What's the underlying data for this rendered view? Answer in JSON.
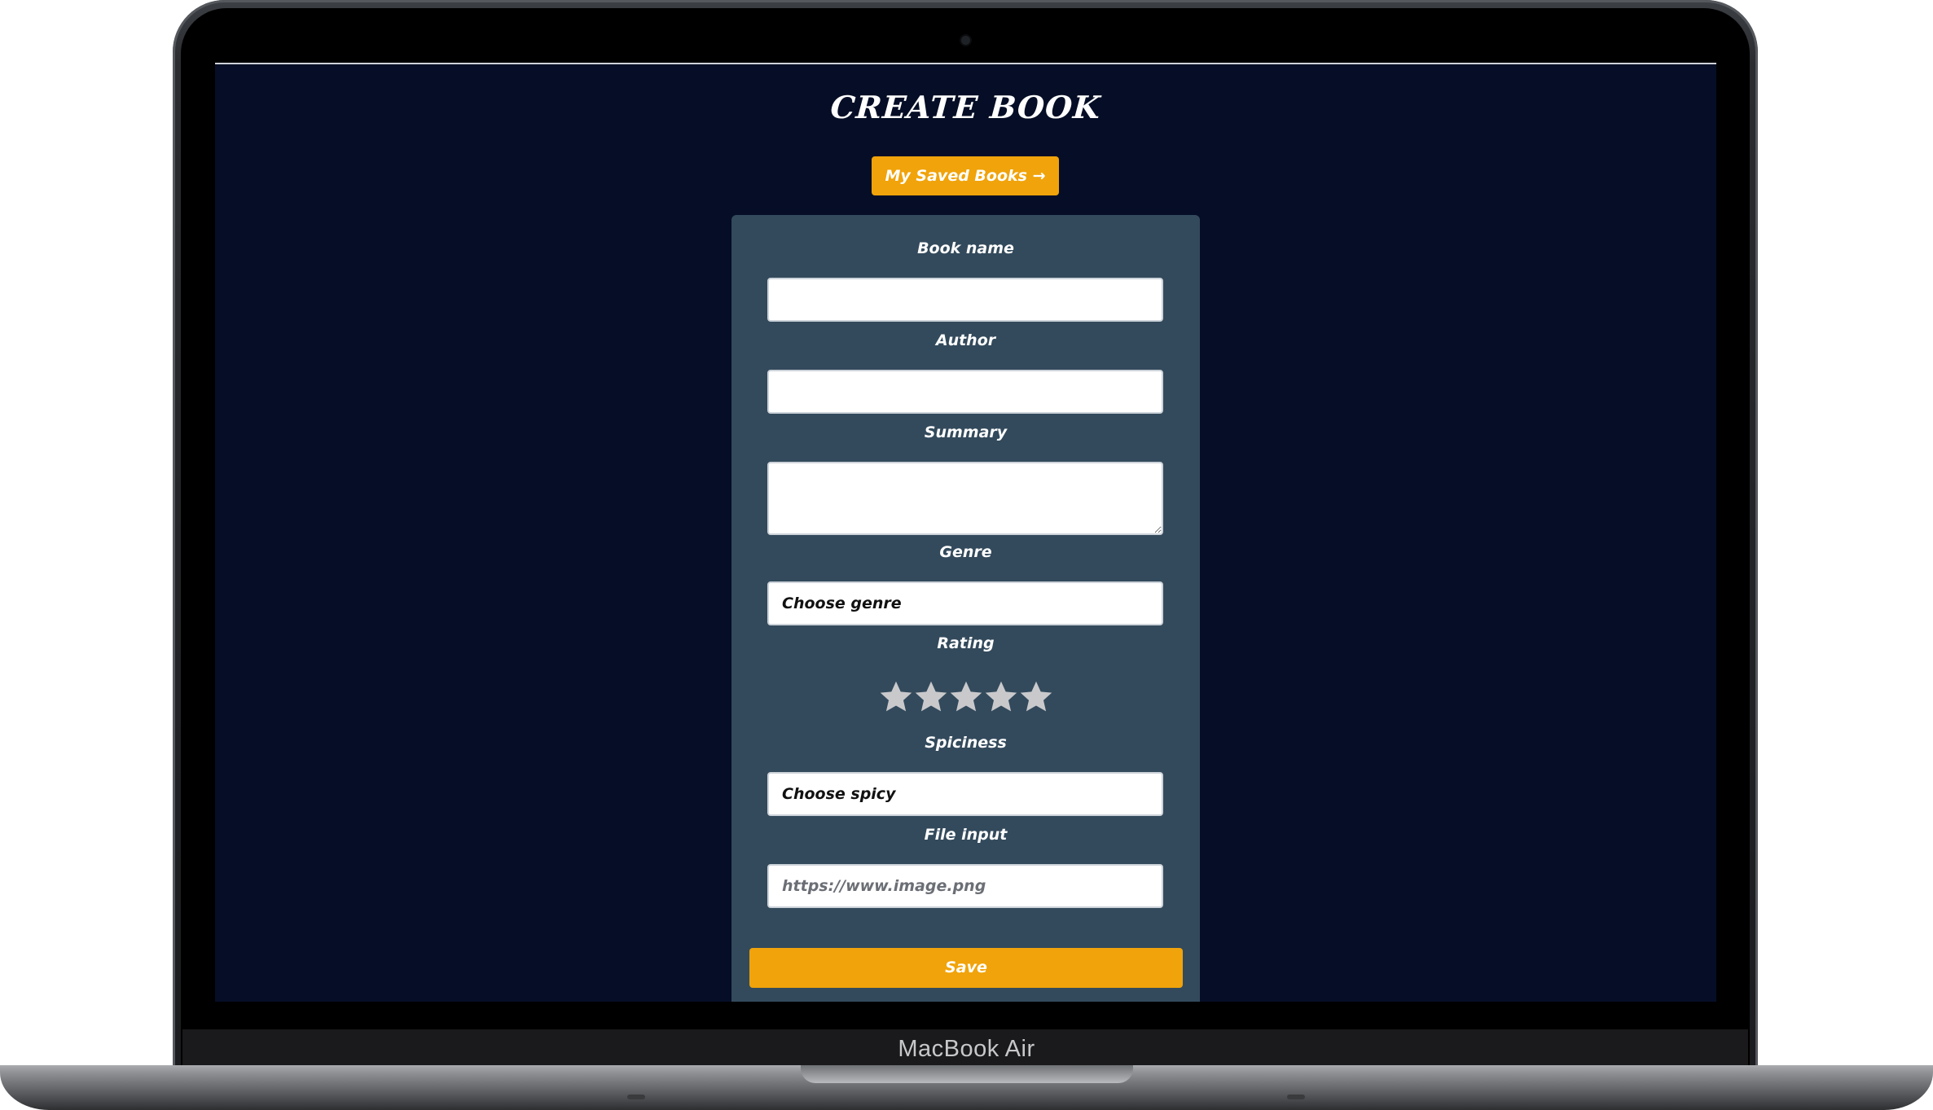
{
  "device": {
    "model_name": "MacBook Air"
  },
  "page": {
    "title": "CREATE BOOK",
    "saved_books_label": "My Saved Books →"
  },
  "form": {
    "book_name": {
      "label": "Book name",
      "value": ""
    },
    "author": {
      "label": "Author",
      "value": ""
    },
    "summary": {
      "label": "Summary",
      "value": ""
    },
    "genre": {
      "label": "Genre",
      "selected": "Choose genre"
    },
    "rating": {
      "label": "Rating",
      "value": 0,
      "max": 5,
      "star_color": "#c9c9cc"
    },
    "spiciness": {
      "label": "Spiciness",
      "selected": "Choose spicy"
    },
    "file_input": {
      "label": "File input",
      "placeholder": "https://www.image.png"
    },
    "save_label": "Save"
  },
  "colors": {
    "background": "#050e26",
    "card": "#334a5c",
    "accent": "#f0a30a"
  }
}
